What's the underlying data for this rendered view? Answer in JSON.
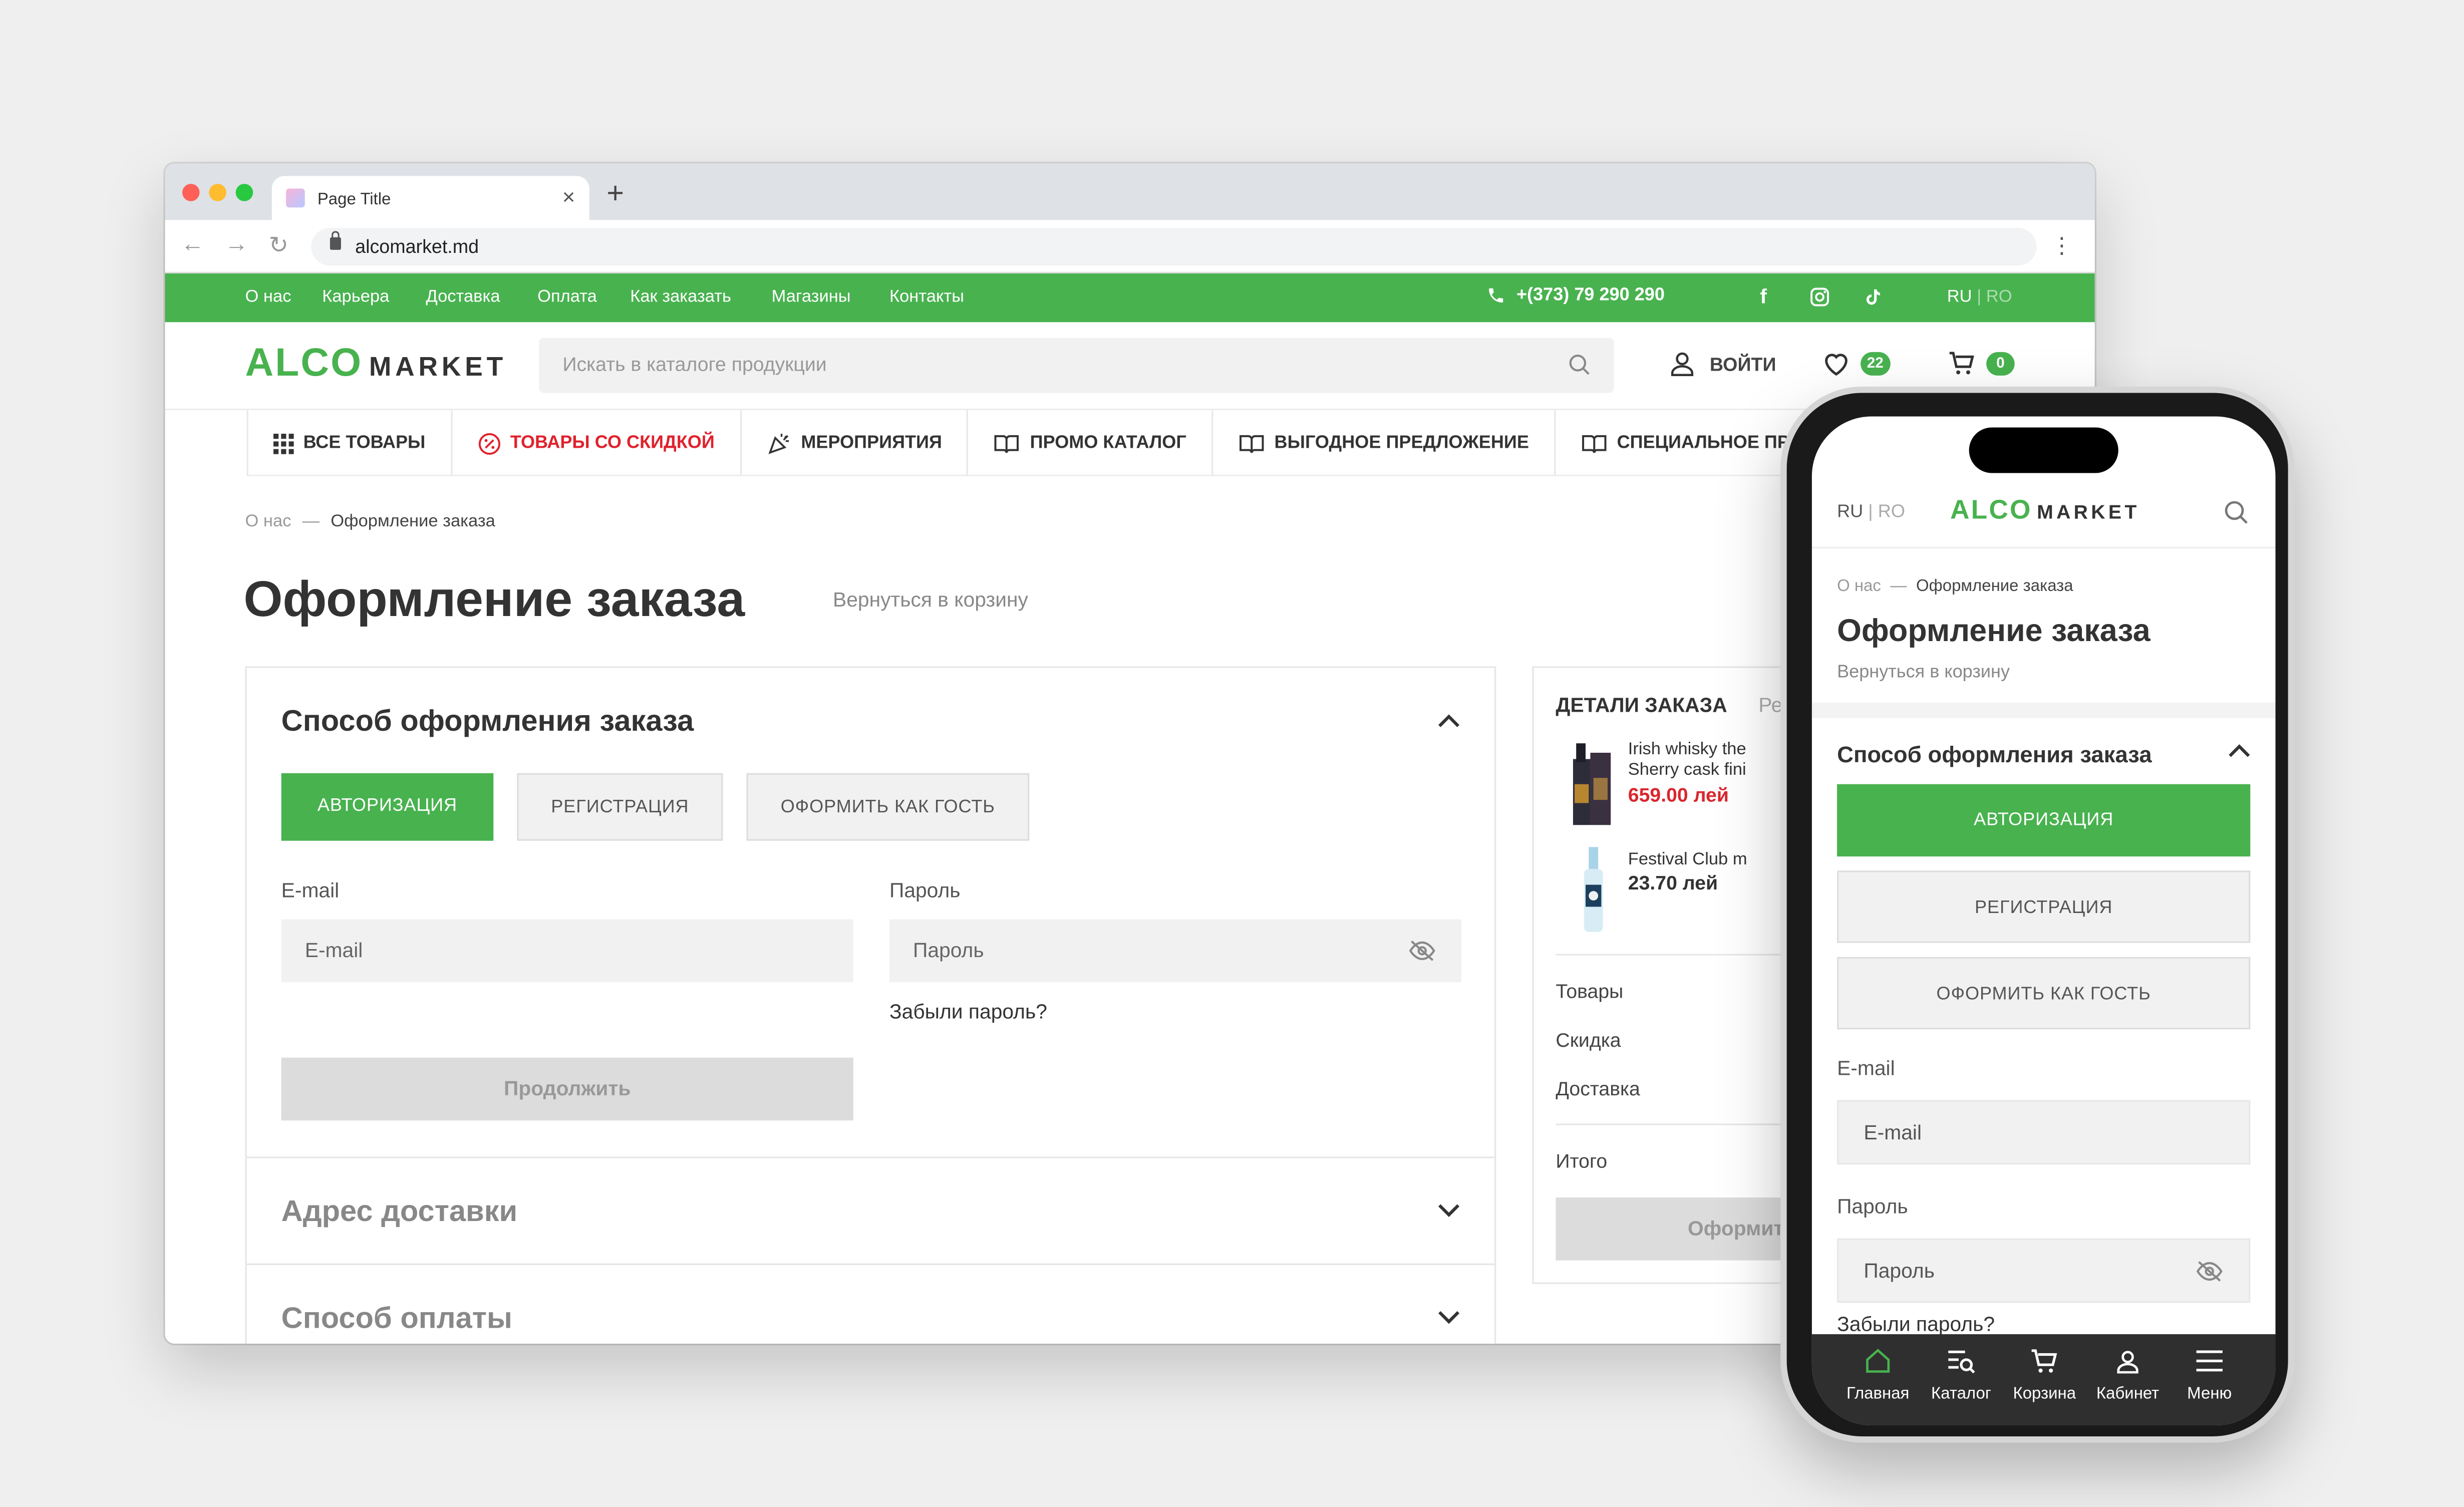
{
  "browser": {
    "tab_title": "Page Title",
    "close_glyph": "×",
    "new_tab_glyph": "+",
    "url": "alcomarket.md",
    "back_glyph": "←",
    "forward_glyph": "→",
    "reload_glyph": "↻",
    "menu_glyph": "⋮"
  },
  "topbar": {
    "links": [
      "О нас",
      "Карьера",
      "Доставка",
      "Оплата",
      "Как заказать",
      "Магазины",
      "Контакты"
    ],
    "phone": "+(373) 79 290 290",
    "social": {
      "facebook": "f",
      "instagram_icon": "instagram-icon",
      "tiktok_icon": "tiktok-icon"
    },
    "lang_active": "RU",
    "lang_sep": "|",
    "lang_other": "RO",
    "bg_color": "#48b24f"
  },
  "header": {
    "logo_alco": "ALCO",
    "logo_market": "MARKET",
    "search_placeholder": "Искать в каталоге продукции",
    "login_label": "ВОЙТИ",
    "wishlist_count": "22",
    "cart_count": "0"
  },
  "categories": [
    {
      "label": "ВСЕ ТОВАРЫ",
      "icon": "grid-icon"
    },
    {
      "label": "ТОВАРЫ СО СКИДКОЙ",
      "icon": "percent-icon"
    },
    {
      "label": "МЕРОПРИЯТИЯ",
      "icon": "party-icon"
    },
    {
      "label": "ПРОМО КАТАЛОГ",
      "icon": "book-icon"
    },
    {
      "label": "ВЫГОДНОЕ ПРЕДЛОЖЕНИЕ",
      "icon": "book-icon"
    },
    {
      "label": "СПЕЦИАЛЬНОЕ ПР",
      "icon": "book-icon"
    }
  ],
  "breadcrumb": {
    "home": "О нас",
    "sep": "—",
    "current": "Оформление заказа"
  },
  "page": {
    "title": "Оформление заказа",
    "back_link": "Вернуться в корзину"
  },
  "checkout": {
    "method_title": "Способ оформления заказа",
    "tabs": [
      "АВТОРИЗАЦИЯ",
      "РЕГИСТРАЦИЯ",
      "ОФОРМИТЬ КАК ГОСТЬ"
    ],
    "email_label": "E-mail",
    "email_placeholder": "E-mail",
    "password_label": "Пароль",
    "password_placeholder": "Пароль",
    "forgot": "Забыли пароль?",
    "continue": "Продолжить",
    "address_title": "Адрес доставки",
    "payment_title": "Способ оплаты"
  },
  "order": {
    "title": "ДЕТАЛИ ЗАКАЗА",
    "title_cut": "Ре",
    "items": [
      {
        "line1": "Irish whisky the",
        "line2": "Sherry cask fini",
        "price": "659.00 лей",
        "price_color": "#d9272e"
      },
      {
        "line1": "Festival Club m",
        "line2": "",
        "price": "23.70 лей",
        "price_color": "#333333"
      }
    ],
    "rows": [
      "Товары",
      "Скидка",
      "Доставка"
    ],
    "total": "Итого",
    "submit": "Оформит"
  },
  "mobile": {
    "lang_active": "RU",
    "lang_sep": "|",
    "lang_other": "RO",
    "breadcrumb_home": "О нас",
    "breadcrumb_sep": "—",
    "breadcrumb_current": "Оформление заказа",
    "title": "Оформление заказа",
    "back_link": "Вернуться в корзину",
    "method_title": "Способ оформления заказа",
    "tabs": [
      "АВТОРИЗАЦИЯ",
      "РЕГИСТРАЦИЯ",
      "ОФОРМИТЬ КАК ГОСТЬ"
    ],
    "email_label": "E-mail",
    "email_placeholder": "E-mail",
    "password_label": "Пароль",
    "password_placeholder": "Пароль",
    "forgot": "Забыли пароль?",
    "tabbar": [
      "Главная",
      "Каталог",
      "Корзина",
      "Кабинет",
      "Меню"
    ]
  },
  "colors": {
    "accent": "#48b24f",
    "discount_red": "#e0212c",
    "price_red": "#d9272e"
  }
}
